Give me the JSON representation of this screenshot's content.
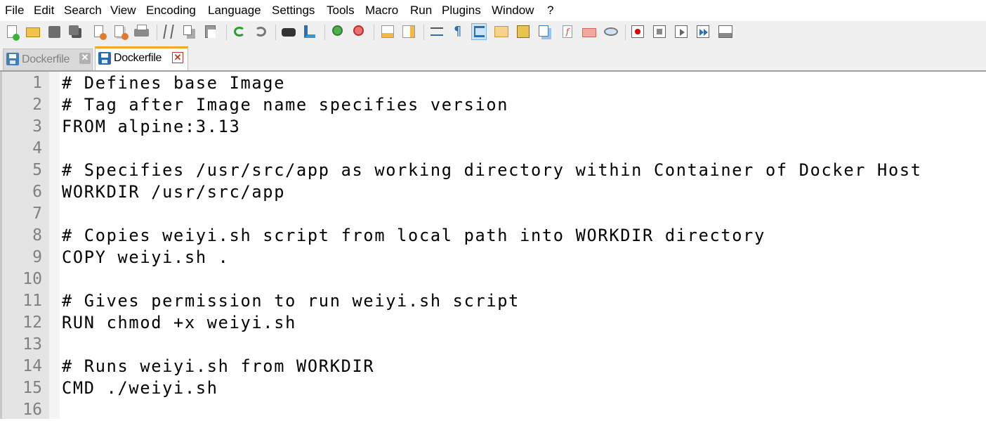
{
  "menu": [
    "File",
    "Edit",
    "Search",
    "View",
    "Encoding",
    "Language",
    "Settings",
    "Tools",
    "Macro",
    "Run",
    "Plugins",
    "Window",
    "?"
  ],
  "toolbar_icons": [
    "new-file-icon",
    "open-file-icon",
    "save-icon",
    "save-all-icon",
    "close-icon",
    "close-all-icon",
    "print-icon",
    "cut-icon",
    "copy-icon",
    "paste-icon",
    "undo-icon",
    "redo-icon",
    "find-icon",
    "replace-icon",
    "zoom-in-icon",
    "zoom-out-icon",
    "sync-vertical-icon",
    "sync-horizontal-icon",
    "word-wrap-icon",
    "show-all-chars-icon",
    "indent-guide-icon",
    "user-language-icon",
    "document-map-icon",
    "document-list-icon",
    "function-list-icon",
    "folder-as-workspace-icon",
    "monitoring-icon",
    "record-macro-icon",
    "stop-recording-icon",
    "playback-macro-icon",
    "run-macro-multiple-icon",
    "save-macro-icon"
  ],
  "tabs": [
    {
      "label": "Dockerfile",
      "state": "inactive"
    },
    {
      "label": "Dockerfile",
      "state": "active"
    }
  ],
  "editor": {
    "lines": [
      {
        "num": "1",
        "text": "# Defines base Image"
      },
      {
        "num": "2",
        "text": "# Tag after Image name specifies version"
      },
      {
        "num": "3",
        "text": "FROM alpine:3.13"
      },
      {
        "num": "4",
        "text": ""
      },
      {
        "num": "5",
        "text": "# Specifies /usr/src/app as working directory within Container of Docker Host"
      },
      {
        "num": "6",
        "text": "WORKDIR /usr/src/app"
      },
      {
        "num": "7",
        "text": ""
      },
      {
        "num": "8",
        "text": "# Copies weiyi.sh script from local path into WORKDIR directory"
      },
      {
        "num": "9",
        "text": "COPY weiyi.sh ."
      },
      {
        "num": "10",
        "text": ""
      },
      {
        "num": "11",
        "text": "# Gives permission to run weiyi.sh script"
      },
      {
        "num": "12",
        "text": "RUN chmod +x weiyi.sh"
      },
      {
        "num": "13",
        "text": ""
      },
      {
        "num": "14",
        "text": "# Runs weiyi.sh from WORKDIR"
      },
      {
        "num": "15",
        "text": "CMD ./weiyi.sh"
      },
      {
        "num": "16",
        "text": ""
      }
    ]
  },
  "colors": {
    "tab_accent": "#f5a623",
    "gutter_bg": "#e4e4e4",
    "line_number": "#808080",
    "close_active": "#c0392b",
    "save_disk_active": "#2b6cb0",
    "save_disk_inactive": "#3f7fc1"
  }
}
